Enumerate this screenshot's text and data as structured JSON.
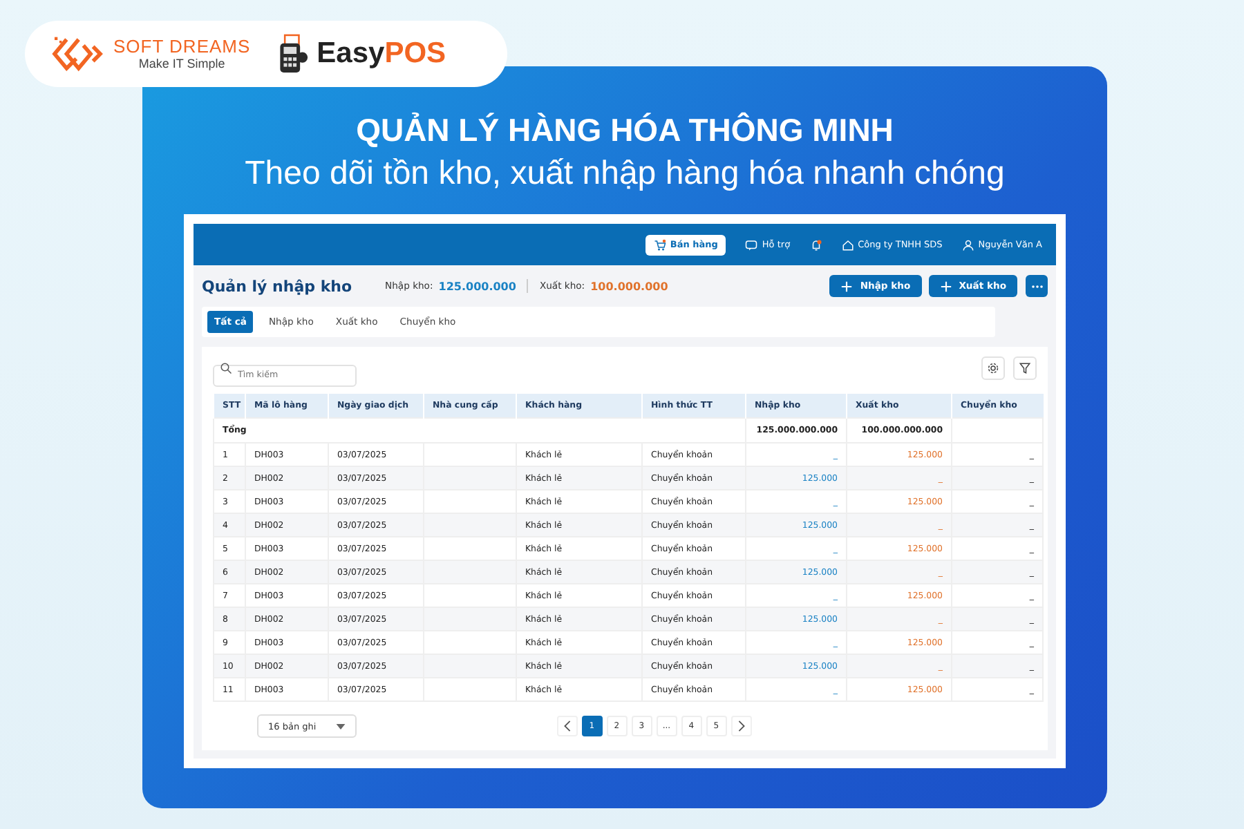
{
  "brands": {
    "softdreams": {
      "name": "SOFT DREAMS",
      "tagline": "Make IT Simple"
    },
    "easypos": {
      "part1": "Easy",
      "part2": "POS"
    }
  },
  "headline": {
    "title": "QUẢN LÝ HÀNG HÓA THÔNG MINH",
    "subtitle": "Theo dõi tồn kho, xuất nhập hàng hóa nhanh chóng"
  },
  "topbar": {
    "sell_button": "Bán hàng",
    "support": "Hỗ trợ",
    "company": "Công ty TNHH SDS",
    "user": "Nguyễn Văn A"
  },
  "page": {
    "title": "Quản lý nhập kho",
    "import_label": "Nhập kho:",
    "import_value": "125.000.000",
    "export_label": "Xuất kho:",
    "export_value": "100.000.000",
    "buttons": [
      "Nhập kho",
      "Xuất kho"
    ]
  },
  "tabs": [
    {
      "label": "Tất cả",
      "selected": true
    },
    {
      "label": "Nhập kho",
      "selected": false
    },
    {
      "label": "Xuất kho",
      "selected": false
    },
    {
      "label": "Chuyển kho",
      "selected": false
    }
  ],
  "search": {
    "placeholder": "Tìm kiếm"
  },
  "table": {
    "columns": [
      "STT",
      "Mã lô hàng",
      "Ngày giao dịch",
      "Nhà cung cấp",
      "Khách hàng",
      "Hình thức TT",
      "Nhập kho",
      "Xuất kho",
      "Chuyển kho"
    ],
    "total": {
      "label": "Tổng",
      "import": "125.000.000.000",
      "export": "100.000.000.000"
    },
    "rows": [
      {
        "stt": "1",
        "code": "DH003",
        "date": "03/07/2025",
        "customer": "Khách lẻ",
        "payment": "Chuyển khoản",
        "import": "_",
        "export": "125.000",
        "transfer": "_"
      },
      {
        "stt": "2",
        "code": "DH002",
        "date": "03/07/2025",
        "customer": "Khách lẻ",
        "payment": "Chuyển khoản",
        "import": "125.000",
        "export": "_",
        "transfer": "_"
      },
      {
        "stt": "3",
        "code": "DH003",
        "date": "03/07/2025",
        "customer": "Khách lẻ",
        "payment": "Chuyển khoản",
        "import": "_",
        "export": "125.000",
        "transfer": "_"
      },
      {
        "stt": "4",
        "code": "DH002",
        "date": "03/07/2025",
        "customer": "Khách lẻ",
        "payment": "Chuyển khoản",
        "import": "125.000",
        "export": "_",
        "transfer": "_"
      },
      {
        "stt": "5",
        "code": "DH003",
        "date": "03/07/2025",
        "customer": "Khách lẻ",
        "payment": "Chuyển khoản",
        "import": "_",
        "export": "125.000",
        "transfer": "_"
      },
      {
        "stt": "6",
        "code": "DH002",
        "date": "03/07/2025",
        "customer": "Khách lẻ",
        "payment": "Chuyển khoản",
        "import": "125.000",
        "export": "_",
        "transfer": "_"
      },
      {
        "stt": "7",
        "code": "DH003",
        "date": "03/07/2025",
        "customer": "Khách lẻ",
        "payment": "Chuyển khoản",
        "import": "_",
        "export": "125.000",
        "transfer": "_"
      },
      {
        "stt": "8",
        "code": "DH002",
        "date": "03/07/2025",
        "customer": "Khách lẻ",
        "payment": "Chuyển khoản",
        "import": "125.000",
        "export": "_",
        "transfer": "_"
      },
      {
        "stt": "9",
        "code": "DH003",
        "date": "03/07/2025",
        "customer": "Khách lẻ",
        "payment": "Chuyển khoản",
        "import": "_",
        "export": "125.000",
        "transfer": "_"
      },
      {
        "stt": "10",
        "code": "DH002",
        "date": "03/07/2025",
        "customer": "Khách lẻ",
        "payment": "Chuyển khoản",
        "import": "125.000",
        "export": "_",
        "transfer": "_"
      },
      {
        "stt": "11",
        "code": "DH003",
        "date": "03/07/2025",
        "customer": "Khách lẻ",
        "payment": "Chuyển khoản",
        "import": "_",
        "export": "125.000",
        "transfer": "_"
      }
    ]
  },
  "page_size": "16 bản ghi",
  "pagination": [
    {
      "label": "1",
      "selected": true
    },
    {
      "label": "2",
      "selected": false
    },
    {
      "label": "3",
      "selected": false
    },
    {
      "label": "...",
      "selected": false
    },
    {
      "label": "4",
      "selected": false
    },
    {
      "label": "5",
      "selected": false
    }
  ]
}
